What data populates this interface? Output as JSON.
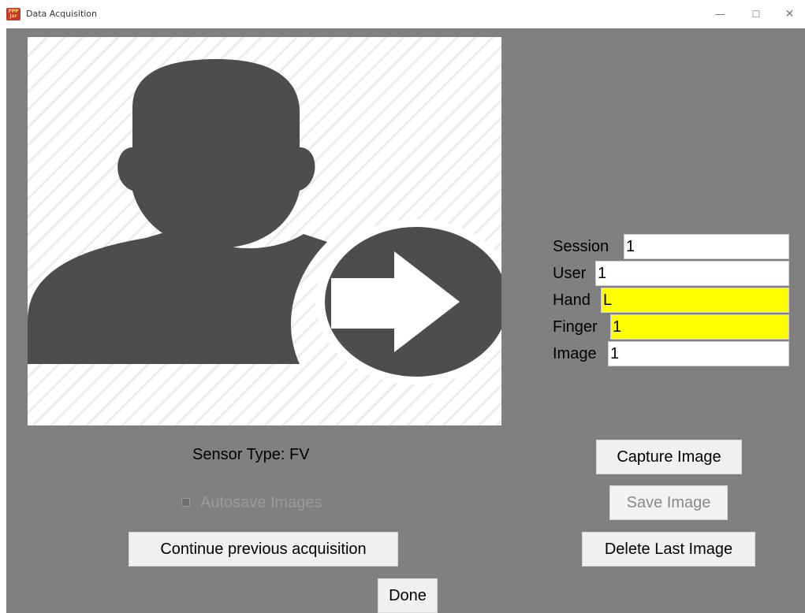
{
  "window": {
    "title": "Data Acquisition",
    "icon_text_top": "PPP",
    "icon_text_bottom": "Jar",
    "controls": {
      "minimize": "—",
      "maximize": "☐",
      "close": "✕"
    }
  },
  "image_panel": {
    "icon": "user-arrow-icon",
    "colors": {
      "figure": "#4d4d4d",
      "stripes": "#ececec",
      "background": "#ffffff"
    }
  },
  "fields": [
    {
      "label": "Session",
      "value": "1",
      "highlight": false
    },
    {
      "label": "User",
      "value": "1",
      "highlight": false
    },
    {
      "label": "Hand",
      "value": "L",
      "highlight": true
    },
    {
      "label": "Finger",
      "value": "1",
      "highlight": true
    },
    {
      "label": "Image",
      "value": "1",
      "highlight": false
    }
  ],
  "sensor": {
    "label": "Sensor Type: FV"
  },
  "autosave": {
    "label": "Autosave Images",
    "checked": false,
    "enabled": false
  },
  "buttons": {
    "continue": "Continue previous acquisition",
    "done": "Done",
    "capture": "Capture Image",
    "save": "Save Image",
    "delete_last": "Delete Last Image"
  },
  "colors": {
    "client_bg": "#808080",
    "highlight": "#ffff00",
    "button_bg": "#f0f0f0"
  }
}
